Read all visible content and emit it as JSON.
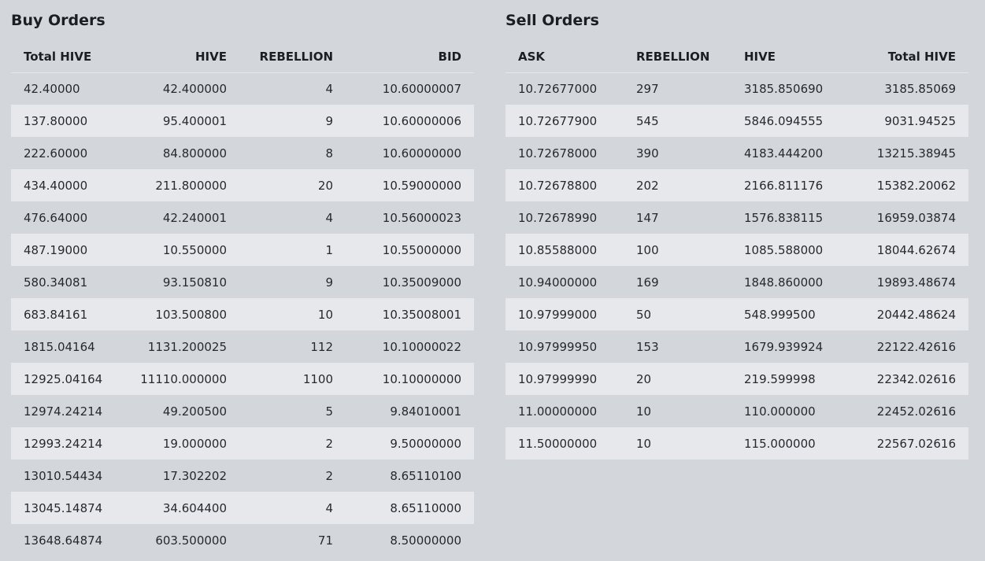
{
  "buy_orders": {
    "title": "Buy Orders",
    "columns": [
      "Total HIVE",
      "HIVE",
      "REBELLION",
      "BID"
    ],
    "rows": [
      [
        "42.40000",
        "42.400000",
        "4",
        "10.60000007"
      ],
      [
        "137.80000",
        "95.400001",
        "9",
        "10.60000006"
      ],
      [
        "222.60000",
        "84.800000",
        "8",
        "10.60000000"
      ],
      [
        "434.40000",
        "211.800000",
        "20",
        "10.59000000"
      ],
      [
        "476.64000",
        "42.240001",
        "4",
        "10.56000023"
      ],
      [
        "487.19000",
        "10.550000",
        "1",
        "10.55000000"
      ],
      [
        "580.34081",
        "93.150810",
        "9",
        "10.35009000"
      ],
      [
        "683.84161",
        "103.500800",
        "10",
        "10.35008001"
      ],
      [
        "1815.04164",
        "1131.200025",
        "112",
        "10.10000022"
      ],
      [
        "12925.04164",
        "11110.000000",
        "1100",
        "10.10000000"
      ],
      [
        "12974.24214",
        "49.200500",
        "5",
        "9.84010001"
      ],
      [
        "12993.24214",
        "19.000000",
        "2",
        "9.50000000"
      ],
      [
        "13010.54434",
        "17.302202",
        "2",
        "8.65110100"
      ],
      [
        "13045.14874",
        "34.604400",
        "4",
        "8.65110000"
      ],
      [
        "13648.64874",
        "603.500000",
        "71",
        "8.50000000"
      ]
    ]
  },
  "sell_orders": {
    "title": "Sell Orders",
    "columns": [
      "ASK",
      "REBELLION",
      "HIVE",
      "Total HIVE"
    ],
    "rows": [
      [
        "10.72677000",
        "297",
        "3185.850690",
        "3185.85069"
      ],
      [
        "10.72677900",
        "545",
        "5846.094555",
        "9031.94525"
      ],
      [
        "10.72678000",
        "390",
        "4183.444200",
        "13215.38945"
      ],
      [
        "10.72678800",
        "202",
        "2166.811176",
        "15382.20062"
      ],
      [
        "10.72678990",
        "147",
        "1576.838115",
        "16959.03874"
      ],
      [
        "10.85588000",
        "100",
        "1085.588000",
        "18044.62674"
      ],
      [
        "10.94000000",
        "169",
        "1848.860000",
        "19893.48674"
      ],
      [
        "10.97999000",
        "50",
        "548.999500",
        "20442.48624"
      ],
      [
        "10.97999950",
        "153",
        "1679.939924",
        "22122.42616"
      ],
      [
        "10.97999990",
        "20",
        "219.599998",
        "22342.02616"
      ],
      [
        "11.00000000",
        "10",
        "110.000000",
        "22452.02616"
      ],
      [
        "11.50000000",
        "10",
        "115.000000",
        "22567.02616"
      ]
    ]
  },
  "colors": {
    "background": "#d3d6db",
    "row_alt": "#e6e8eb",
    "price_red": "#e5484d",
    "text": "#26292e"
  }
}
